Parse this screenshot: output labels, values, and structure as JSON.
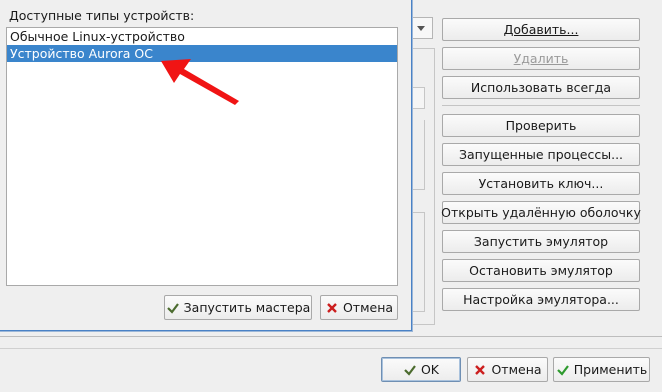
{
  "dialog": {
    "label": "Доступные типы устройств:",
    "device_types": [
      {
        "label": "Обычное Linux-устройство",
        "selected": false
      },
      {
        "label": "Устройство Aurora ОС",
        "selected": true
      }
    ],
    "wizard_button": "Запустить мастера",
    "cancel_button": "Отмена"
  },
  "side_buttons": {
    "add": "Добавить...",
    "remove": "Удалить",
    "default": "Использовать всегда",
    "test": "Проверить",
    "processes": "Запущенные процессы...",
    "deploy_key": "Установить ключ...",
    "open_shell": "Открыть удалённую оболочку",
    "start_emulator": "Запустить эмулятор",
    "stop_emulator": "Остановить эмулятор",
    "emulator_settings": "Настройка эмулятора..."
  },
  "footer": {
    "ok": "OK",
    "cancel": "Отмена",
    "apply": "Применить"
  },
  "colors": {
    "selection": "#3a85cc",
    "dialog_border": "#4a82c6",
    "arrow": "#f01414",
    "ok_check": "#2e9a2e",
    "cancel_x": "#cc1f1f"
  }
}
